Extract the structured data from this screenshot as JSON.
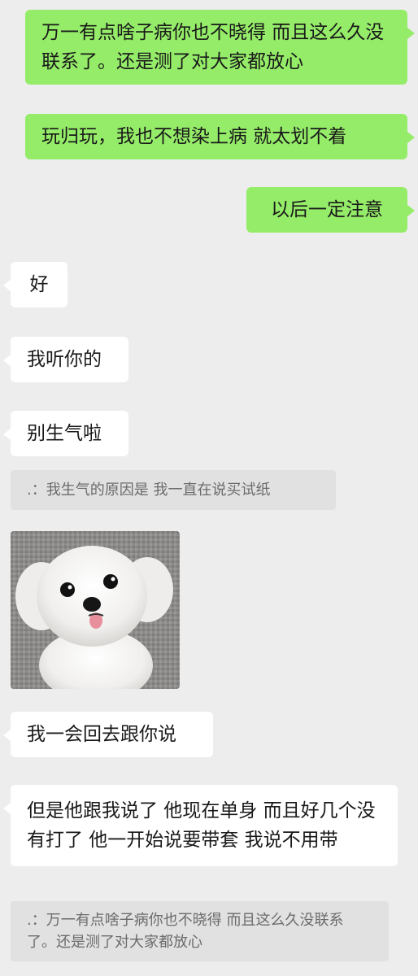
{
  "messages": [
    {
      "side": "out",
      "text": "万一有点啥子病你也不晓得 而且这么久没联系了。还是测了对大家都放心"
    },
    {
      "side": "out",
      "text": "玩归玩，我也不想染上病 就太划不着"
    },
    {
      "side": "out",
      "text": "以后一定注意"
    },
    {
      "side": "in",
      "text": "好"
    },
    {
      "side": "in",
      "text": "我听你的"
    },
    {
      "side": "in",
      "text": "别生气啦"
    },
    {
      "quote": ".：我生气的原因是 我一直在说买试纸"
    },
    {
      "image": "sticker-white-puppy"
    },
    {
      "side": "in",
      "text": "我一会回去跟你说"
    },
    {
      "side": "in",
      "text": "但是他跟我说了 他现在单身 而且好几个没有打了 他一开始说要带套 我说不用带"
    },
    {
      "quote": ".：万一有点啥子病你也不晓得 而且这么久没联系了。还是测了对大家都放心"
    }
  ],
  "colors": {
    "background": "#ededed",
    "outgoing_bubble": "#95ec69",
    "incoming_bubble": "#ffffff",
    "quote_bg": "#e1e1e1"
  }
}
